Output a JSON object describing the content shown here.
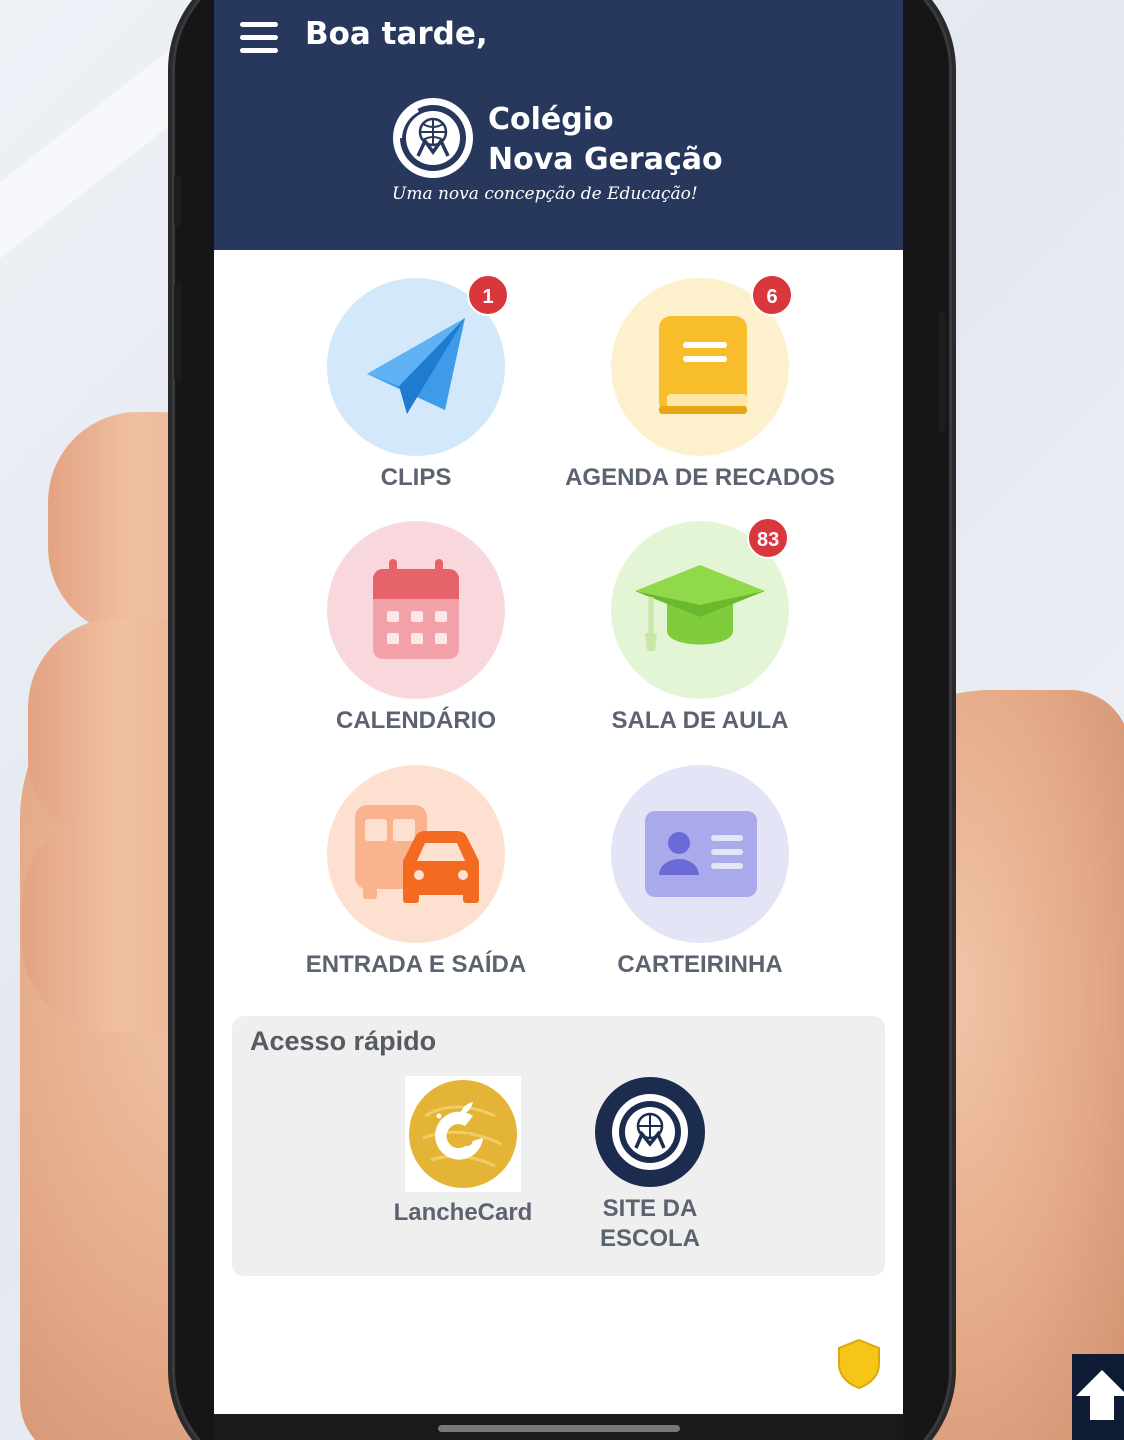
{
  "header": {
    "greeting": "Boa tarde,",
    "school_name_line1": "Colégio",
    "school_name_line2": "Nova Geração",
    "school_tagline": "Uma nova concepção de Educação!",
    "menu_icon": "hamburger-menu-icon",
    "background_color": "#27385c"
  },
  "tiles": [
    {
      "label": "CLIPS",
      "icon": "paper-plane-icon",
      "badge": "1",
      "circle_color": "#d3e8fb",
      "icon_color": "#3d9be9"
    },
    {
      "label": "AGENDA DE RECADOS",
      "icon": "book-icon",
      "badge": "6",
      "circle_color": "#fdf0cc",
      "icon_color": "#f7bd2b"
    },
    {
      "label": "CALENDÁRIO",
      "icon": "calendar-icon",
      "badge": "",
      "circle_color": "#f8d8dc",
      "icon_color": "#e7636b"
    },
    {
      "label": "SALA DE AULA",
      "icon": "graduation-cap-icon",
      "badge": "83",
      "circle_color": "#e4f5d5",
      "icon_color": "#7fcc3c"
    },
    {
      "label": "ENTRADA E SAÍDA",
      "icon": "bus-car-icon",
      "badge": "",
      "circle_color": "#fde0cf",
      "icon_color": "#f36b21"
    },
    {
      "label": "CARTEIRINHA",
      "icon": "id-card-icon",
      "badge": "",
      "circle_color": "#e4e4f7",
      "icon_color": "#6a6bd6"
    }
  ],
  "quick_access": {
    "title": "Acesso rápido",
    "items": [
      {
        "label": "LancheCard",
        "icon": "lanchecard-logo-icon"
      },
      {
        "label": "SITE DA ESCOLA",
        "icon": "school-logo-icon"
      }
    ]
  },
  "colors": {
    "badge": "#d9373c",
    "label_text": "#5c6370",
    "quick_access_bg": "#efefef",
    "shield": "#f5c518"
  }
}
